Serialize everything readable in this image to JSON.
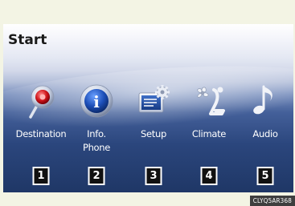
{
  "screen": {
    "title": "Start",
    "menu": [
      {
        "label": "Destination",
        "number": "1",
        "icon": "destination-pin-icon"
      },
      {
        "label": "Info.\nPhone",
        "number": "2",
        "icon": "info-icon"
      },
      {
        "label": "Setup",
        "number": "3",
        "icon": "setup-gear-icon"
      },
      {
        "label": "Climate",
        "number": "4",
        "icon": "climate-fan-seat-icon"
      },
      {
        "label": "Audio",
        "number": "5",
        "icon": "music-note-icon"
      }
    ]
  },
  "caption": "CLYQ5AR368"
}
